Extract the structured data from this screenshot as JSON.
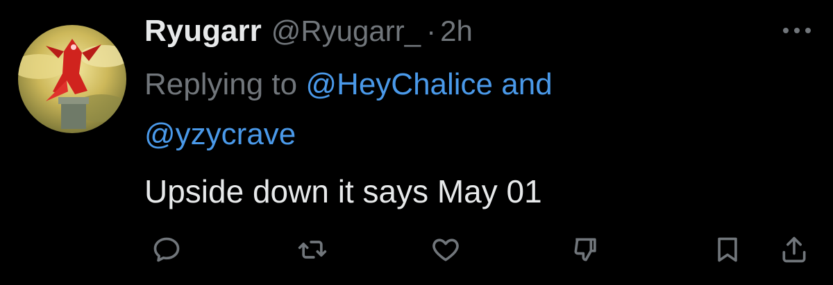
{
  "author": {
    "display_name": "Ryugarr",
    "handle": "@Ryugarr_",
    "separator": "·",
    "time": "2h"
  },
  "reply": {
    "prefix": "Replying to",
    "mention_1": "@HeyChalice",
    "connector": "and",
    "mention_2": "@yzycrave"
  },
  "tweet": {
    "text": "Upside down it says May 01"
  },
  "actions": [
    {
      "name": "reply",
      "icon": "reply-icon"
    },
    {
      "name": "retweet",
      "icon": "retweet-icon"
    },
    {
      "name": "like",
      "icon": "heart-icon"
    },
    {
      "name": "dislike",
      "icon": "thumbs-down-icon"
    },
    {
      "name": "bookmark",
      "icon": "bookmark-icon"
    },
    {
      "name": "share",
      "icon": "share-icon"
    }
  ],
  "colors": {
    "background": "#000000",
    "primary_text": "#e7e9ea",
    "secondary_text": "#71767b",
    "link": "#4a99e9"
  }
}
